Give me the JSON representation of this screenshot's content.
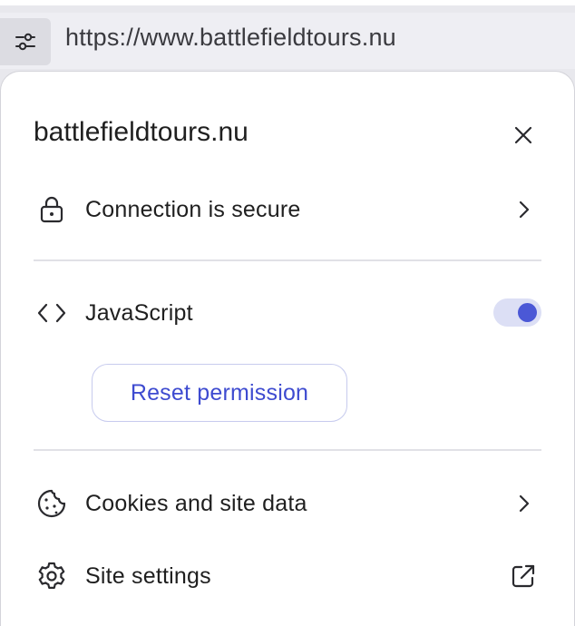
{
  "address_bar": {
    "url": "https://www.battlefieldtours.nu",
    "site_info_icon": "tune-icon"
  },
  "panel": {
    "title": "battlefieldtours.nu",
    "close_icon": "close-icon",
    "connection": {
      "label": "Connection is secure",
      "icon": "lock-icon",
      "trail_icon": "chevron-right-icon"
    },
    "javascript": {
      "label": "JavaScript",
      "icon": "code-icon",
      "enabled": true
    },
    "reset_permission": {
      "label": "Reset permission"
    },
    "cookies": {
      "label": "Cookies and site data",
      "icon": "cookie-icon",
      "trail_icon": "chevron-right-icon"
    },
    "site_settings": {
      "label": "Site settings",
      "icon": "gear-icon",
      "trail_icon": "open-external-icon"
    }
  },
  "colors": {
    "accent": "#4b58d6",
    "accent_text": "#3e4bd0",
    "toggle_track": "#dcdff5"
  }
}
